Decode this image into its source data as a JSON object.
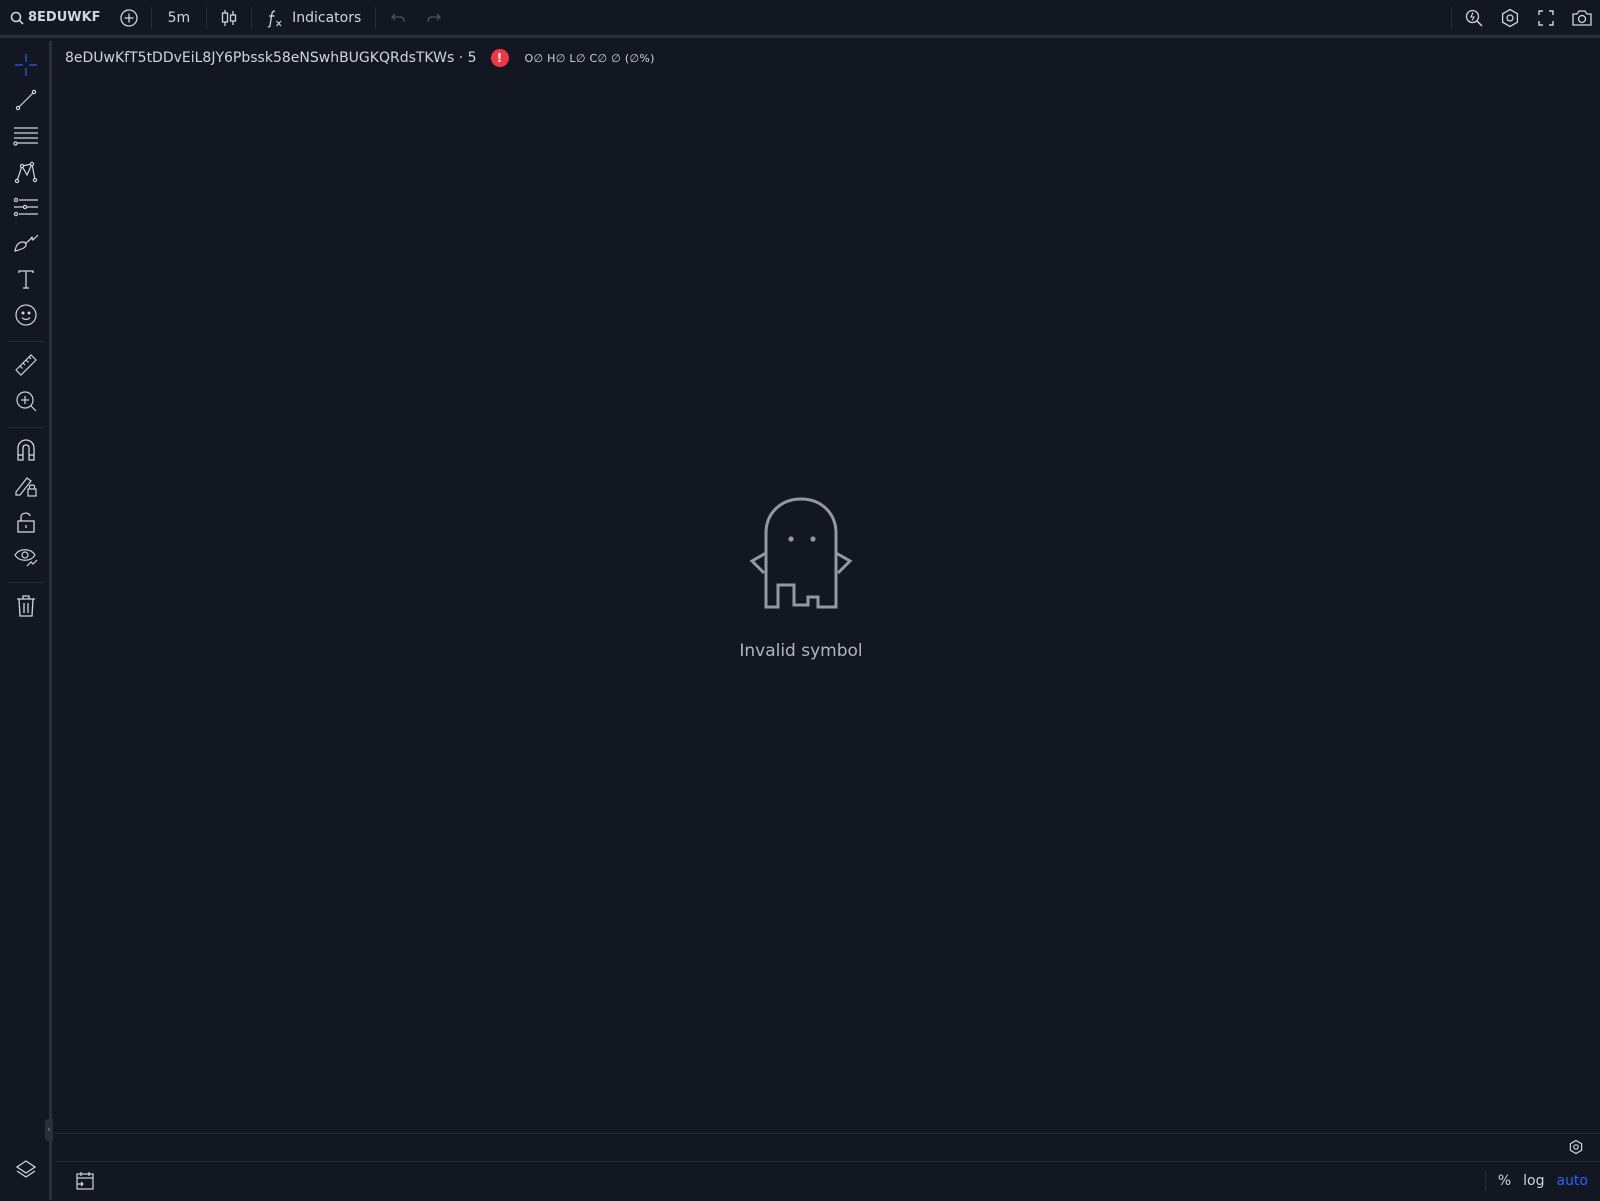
{
  "toolbar": {
    "symbol": "8EDUWKF",
    "interval": "5m",
    "indicators_label": "Indicators"
  },
  "legend": {
    "title": "8eDUwKfT5tDDvEiL8JY6Pbssk58eNSwhBUGKQRdsTKWs · 5",
    "error_glyph": "!",
    "ohlc": "O∅ H∅ L∅ C∅ ∅ (∅%)"
  },
  "chart": {
    "empty_message": "Invalid symbol"
  },
  "bottom": {
    "percent": "%",
    "log": "log",
    "auto": "auto"
  },
  "collapse_glyph": "‹",
  "colors": {
    "background": "#131722",
    "border": "#2a2e39",
    "text": "#d1d4dc",
    "accent": "#2962ff",
    "error": "#f23645",
    "ghost": "#9598a1"
  },
  "icons": {
    "left_toolbar": [
      "crosshair-icon",
      "trend-line-icon",
      "fib-retracement-icon",
      "pattern-icon",
      "prediction-icon",
      "brush-icon",
      "text-icon",
      "emoji-icon",
      "ruler-icon",
      "zoom-in-icon",
      "magnet-icon",
      "lock-drawing-icon",
      "unlock-icon",
      "eye-icon",
      "trash-icon",
      "layers-icon"
    ]
  }
}
